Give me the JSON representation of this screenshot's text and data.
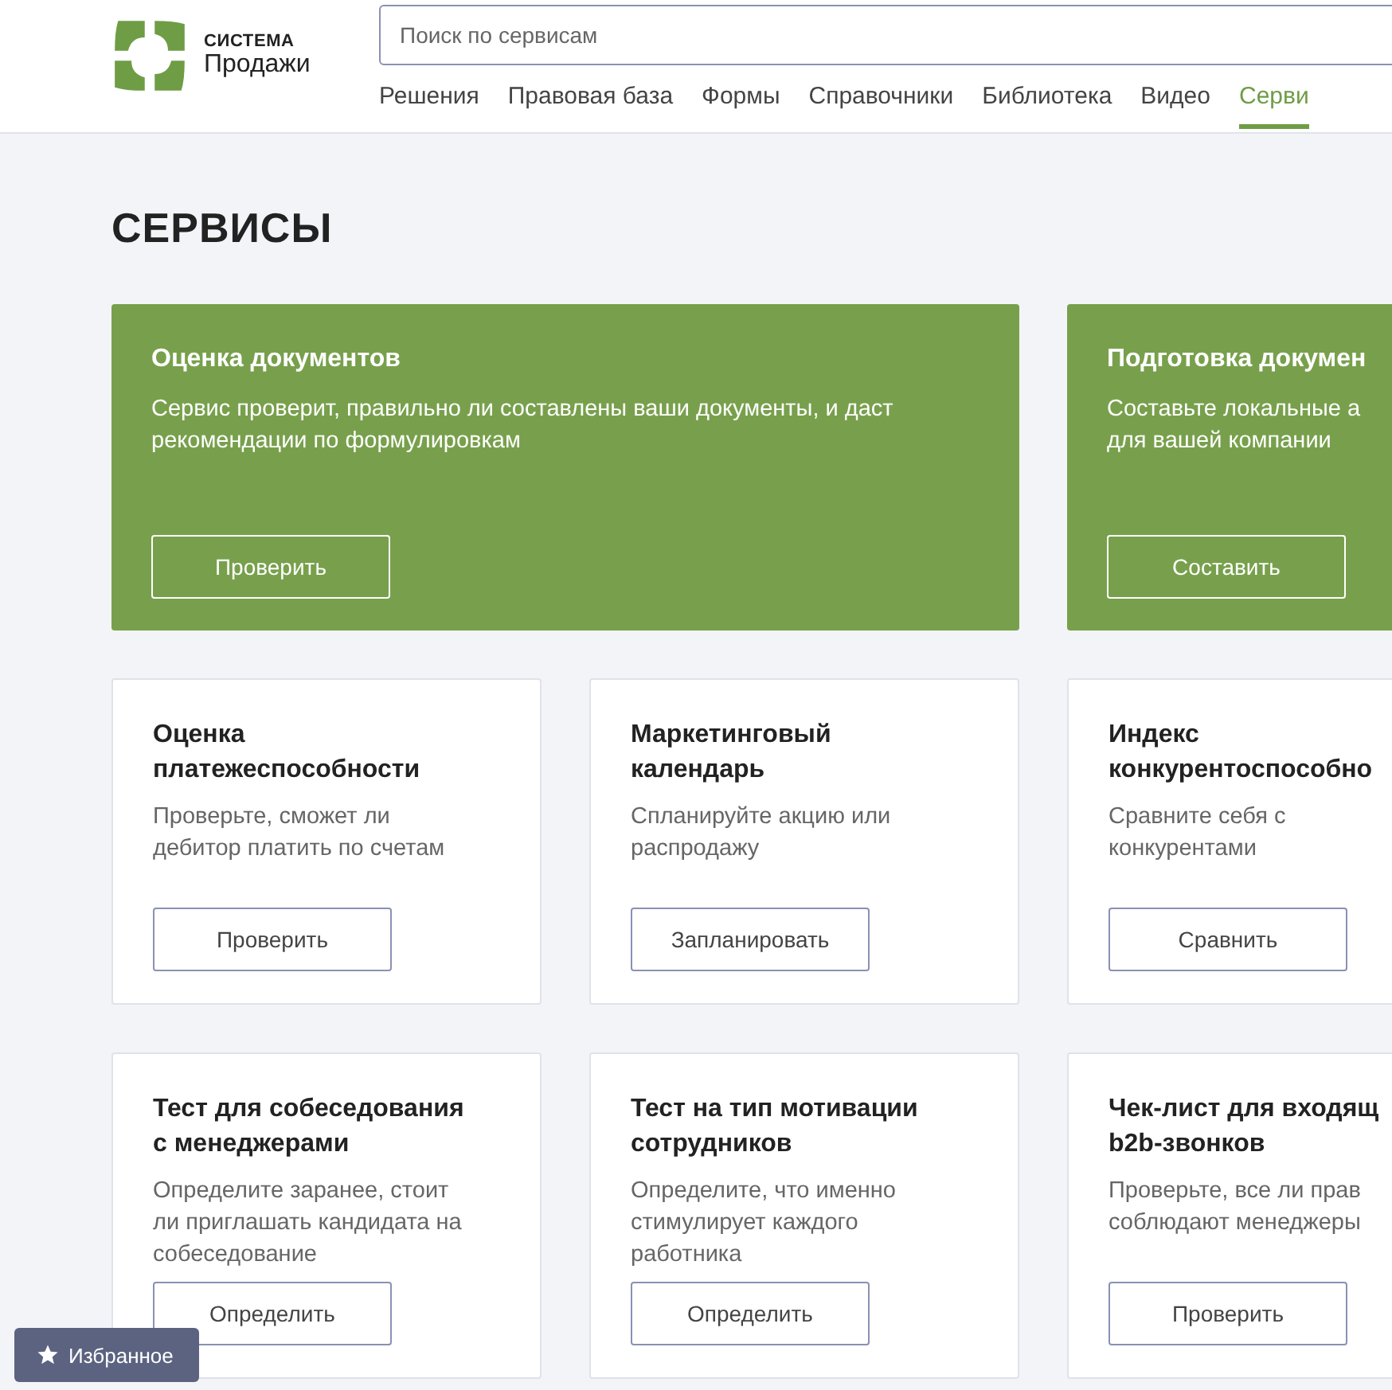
{
  "logo": {
    "top": "СИСТЕМА",
    "bottom": "Продажи"
  },
  "search": {
    "placeholder": "Поиск по сервисам"
  },
  "nav": [
    {
      "label": "Решения",
      "selected": false
    },
    {
      "label": "Правовая база",
      "selected": false
    },
    {
      "label": "Формы",
      "selected": false
    },
    {
      "label": "Справочники",
      "selected": false
    },
    {
      "label": "Библиотека",
      "selected": false
    },
    {
      "label": "Видео",
      "selected": false
    },
    {
      "label": "Серви",
      "selected": true
    }
  ],
  "page_title": "СЕРВИСЫ",
  "rows": [
    {
      "cards": [
        {
          "kind": "featured",
          "title": "Оценка документов",
          "description": "Сервис проверит, правильно ли составлены ваши документы, и даст рекомендации по формулировкам",
          "button": "Проверить"
        },
        {
          "kind": "featured",
          "title": "Подготовка докумен",
          "description": "Составьте локальные а\nдля вашей компании",
          "button": "Составить"
        }
      ]
    },
    {
      "cards": [
        {
          "kind": "regular",
          "title": "Оценка платежеспособности",
          "description": "Проверьте, сможет ли дебитор платить по счетам",
          "button": "Проверить"
        },
        {
          "kind": "regular",
          "title": "Маркетинговый календарь",
          "description": "Спланируйте акцию или распродажу",
          "button": "Запланировать"
        },
        {
          "kind": "regular",
          "title": "Индекс\nконкурентоспособно",
          "description": "Сравните себя с конкурентами",
          "button": "Сравнить"
        }
      ]
    },
    {
      "cards": [
        {
          "kind": "regular",
          "title": "Тест для собеседования с менеджерами",
          "description": "Определите заранее, стоит ли приглашать кандидата на собеседование",
          "button": "Определить"
        },
        {
          "kind": "regular",
          "title": "Тест на тип мотивации сотрудников",
          "description": "Определите, что именно стимулирует каждого работника",
          "button": "Определить"
        },
        {
          "kind": "regular",
          "title": "Чек-лист для входящ\nb2b-звонков",
          "description": "Проверьте, все ли прав\nсоблюдают менеджеры",
          "button": "Проверить"
        }
      ]
    }
  ],
  "favorites": {
    "label": "Избранное"
  }
}
